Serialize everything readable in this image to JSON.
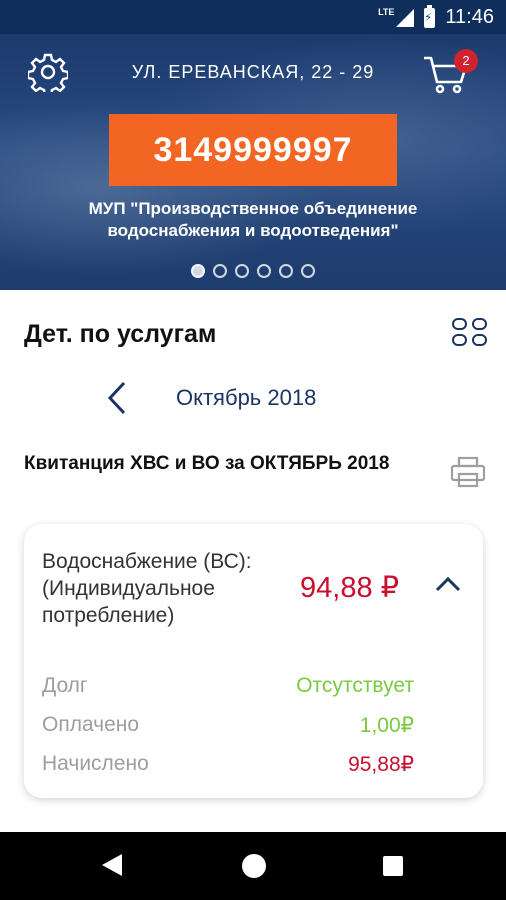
{
  "status_bar": {
    "time": "11:46",
    "network": "LTE"
  },
  "header": {
    "address": "УЛ. ЕРЕВАНСКАЯ, 22 - 29",
    "cart_count": "2",
    "account_number": "3149999997",
    "provider": "МУП \"Производственное объединение водоснабжения и водоотведения\"",
    "carousel_dots": 6,
    "carousel_active": 0
  },
  "section": {
    "title": "Дет. по услугам"
  },
  "month": {
    "label": "Октябрь 2018"
  },
  "receipt": {
    "title": "Квитанция ХВС и ВО за ОКТЯБРЬ 2018"
  },
  "service": {
    "name": "Водоснабжение (ВС): (Индивидуальное потребление)",
    "sum": "94,88 ₽",
    "rows": [
      {
        "label": "Долг",
        "value": "Отсутствует",
        "color": "#7ac943"
      },
      {
        "label": "Оплачено",
        "value": "1,00₽",
        "color": "#7ac943"
      },
      {
        "label": "Начислено",
        "value": "95,88₽",
        "color": "#c8102e"
      }
    ]
  },
  "colors": {
    "accent": "#f26522",
    "brand": "#1c3560",
    "negative": "#c8102e",
    "positive": "#7ac943"
  }
}
